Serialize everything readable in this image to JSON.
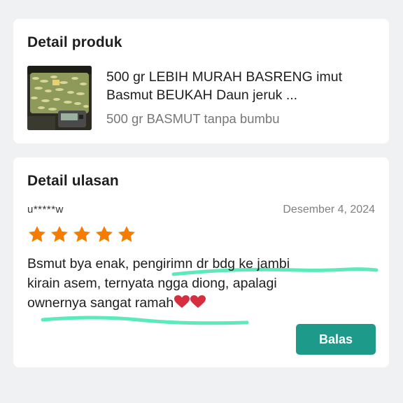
{
  "product_section": {
    "title": "Detail produk",
    "product_name": "500 gr LEBIH MURAH BASRENG imut Basmut BEUKAH Daun jeruk ...",
    "variant": "500 gr BASMUT tanpa bumbu",
    "thumbnail_icon": "product-photo"
  },
  "review_section": {
    "title": "Detail ulasan",
    "reviewer": "u*****w",
    "date": "Desember 4, 2024",
    "rating": 5,
    "rating_max": 5,
    "star_color": "#f57c00",
    "text_line_1": "Bsmut bya enak, pengirimn dr bdg ke jambi",
    "text_line_2": "kirain asem, ternyata ngga diong, apalagi",
    "text_line_3": "ownernya sangat ramah",
    "highlight_color": "#3fe6b0",
    "heart_color": "#d62d3f",
    "reply_label": "Balas",
    "reply_color": "#1e9a8b"
  }
}
